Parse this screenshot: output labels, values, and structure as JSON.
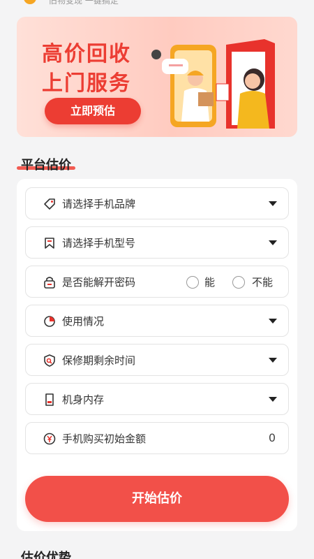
{
  "top_tip": "旧物变现 一键搞定",
  "banner": {
    "title_line1": "高价回收",
    "title_line2": "上门服务",
    "cta_label": "立即预估"
  },
  "estimate": {
    "section_title": "平台估价",
    "rows": [
      {
        "label": "请选择手机品牌",
        "icon": "tag-icon"
      },
      {
        "label": "请选择手机型号",
        "icon": "bookmark-icon"
      },
      {
        "label": "是否能解开密码",
        "icon": "lock-icon"
      },
      {
        "label": "使用情况",
        "icon": "pie-chart-icon"
      },
      {
        "label": "保修期剩余时间",
        "icon": "shield-icon"
      },
      {
        "label": "机身内存",
        "icon": "sd-card-icon"
      },
      {
        "label": "手机购买初始金额",
        "icon": "yen-icon"
      }
    ],
    "password_options": [
      "能",
      "不能"
    ],
    "purchase_amount_value": "0",
    "submit_label": "开始估价"
  },
  "next_section_title": "估价优势",
  "colors": {
    "accent": "#f25049",
    "banner_text": "#ec3d33"
  }
}
